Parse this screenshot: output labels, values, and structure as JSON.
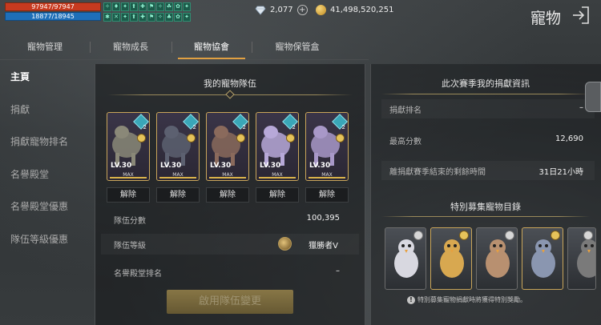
{
  "status": {
    "hp": "97947/97947",
    "mp": "18877/18945",
    "buffs": [
      "✧",
      "♦",
      "✦",
      "⬆",
      "✚",
      "⚑",
      "✧",
      "☘",
      "✿",
      "✦",
      "✱",
      "✕",
      "✦",
      "⬆",
      "✚",
      "⚑",
      "✧",
      "♣",
      "✿",
      "✦"
    ]
  },
  "currency": {
    "diamonds": "2,077",
    "gold": "41,498,520,251"
  },
  "header": {
    "title": "寵物"
  },
  "tabs": [
    {
      "label": "寵物管理"
    },
    {
      "label": "寵物成長"
    },
    {
      "label": "寵物協會"
    },
    {
      "label": "寵物保管盒"
    }
  ],
  "active_tab": "寵物協會",
  "sidebar": {
    "items": [
      {
        "label": "主頁"
      },
      {
        "label": "捐獻"
      },
      {
        "label": "捐獻寵物排名"
      },
      {
        "label": "名譽殿堂"
      },
      {
        "label": "名譽殿堂優惠"
      },
      {
        "label": "隊伍等級優惠"
      }
    ]
  },
  "team": {
    "title": "我的寵物隊伍",
    "pets": [
      {
        "level": "LV.30",
        "max": "MAX",
        "gem": "2",
        "color": "#8a8878"
      },
      {
        "level": "LV.30",
        "max": "MAX",
        "gem": "2",
        "color": "#5c6070"
      },
      {
        "level": "LV.30",
        "max": "MAX",
        "gem": "2",
        "color": "#8a6a5c"
      },
      {
        "level": "LV.30",
        "max": "MAX",
        "gem": "2",
        "color": "#b7a8d8"
      },
      {
        "level": "LV.30",
        "max": "MAX",
        "gem": "2",
        "color": "#a898c8"
      }
    ],
    "release_label": "解除",
    "stats": [
      {
        "label": "隊伍分數",
        "value": "100,395"
      },
      {
        "label": "隊伍等級",
        "value": "獵勝者V"
      },
      {
        "label": "名譽殿堂排名",
        "value": "–"
      }
    ],
    "apply_label": "啟用隊伍變更"
  },
  "season": {
    "title": "此次賽季我的捐獻資訊",
    "rows": [
      {
        "label": "捐獻排名",
        "value": "–"
      },
      {
        "label": "最高分數",
        "value": "12,690"
      },
      {
        "label": "離捐獻賽季結束的剩餘時間",
        "value": "31日21小時"
      }
    ]
  },
  "special": {
    "title": "特別募集寵物目錄",
    "note": "特別募集寵物捐獻時將獲得特別獎勵。",
    "pets": [
      {
        "color": "#d8d8e0",
        "gold": false
      },
      {
        "color": "#d8a850",
        "gold": true
      },
      {
        "color": "#b89070",
        "gold": false
      },
      {
        "color": "#8a96b0",
        "gold": true
      },
      {
        "color": "#7a7a7a",
        "gold": false
      }
    ]
  }
}
